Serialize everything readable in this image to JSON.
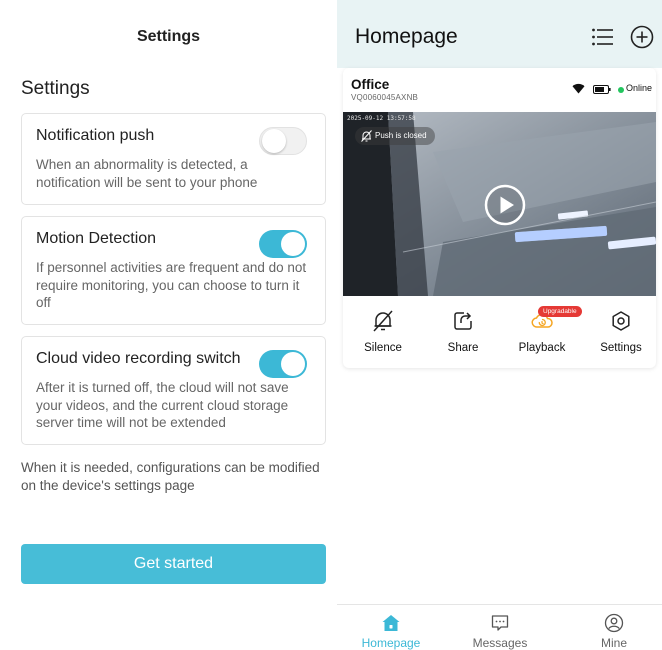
{
  "left_panel": {
    "header_title": "Settings",
    "section_title": "Settings",
    "cards": [
      {
        "title": "Notification push",
        "description": "When an abnormality is detected, a notification will be sent to your phone",
        "enabled": false
      },
      {
        "title": "Motion Detection",
        "description": "If personnel activities are frequent and do not require monitoring, you can choose to turn it off",
        "enabled": true
      },
      {
        "title": "Cloud video recording switch",
        "description": "After it is turned off, the cloud will not save your videos, and the current cloud storage server time will not be extended",
        "enabled": true
      }
    ],
    "footnote": "When it is needed, configurations can be modified on the device's settings page",
    "cta_label": "Get started"
  },
  "right_panel": {
    "title": "Homepage",
    "icons": {
      "menu": "list-icon",
      "add": "plus-circle-icon"
    },
    "device": {
      "name": "Office",
      "id": "VQ0060045AXNB",
      "status": "Online",
      "video_timestamp": "2025-09-12 13:57:58",
      "push_status": "Push is closed",
      "actions": [
        {
          "label": "Silence",
          "icon": "bell-off-icon"
        },
        {
          "label": "Share",
          "icon": "share-icon"
        },
        {
          "label": "Playback",
          "icon": "cloud-playback-icon",
          "badge": "Upgradable"
        },
        {
          "label": "Settings",
          "icon": "settings-icon"
        }
      ]
    },
    "bottom_nav": [
      {
        "label": "Homepage",
        "icon": "home-icon",
        "active": true
      },
      {
        "label": "Messages",
        "icon": "message-icon",
        "active": false
      },
      {
        "label": "Mine",
        "icon": "user-icon",
        "active": false
      }
    ]
  },
  "colors": {
    "accent": "#3cb8d6",
    "button": "#47bdd7",
    "topbar_bg": "#e8f3f4",
    "online": "#22c55e",
    "badge": "#e53935"
  }
}
